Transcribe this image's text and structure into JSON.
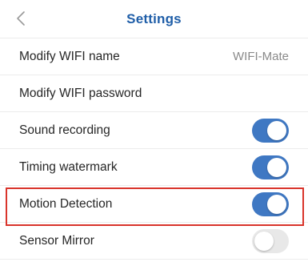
{
  "header": {
    "title": "Settings",
    "back_icon": "chevron-left-icon"
  },
  "settings": {
    "wifi_name": {
      "label": "Modify WIFI name",
      "value": "WIFI-Mate"
    },
    "wifi_password": {
      "label": "Modify WIFI password"
    },
    "sound_recording": {
      "label": "Sound recording",
      "enabled": true
    },
    "timing_watermark": {
      "label": "Timing watermark",
      "enabled": true
    },
    "motion_detection": {
      "label": "Motion Detection",
      "enabled": true,
      "highlighted": true
    },
    "sensor_mirror": {
      "label": "Sensor Mirror",
      "enabled": false
    }
  },
  "colors": {
    "accent": "#3f78c3",
    "title": "#1f5ea8",
    "toggle_off": "#e8e8e8",
    "highlight_border": "#d9342b",
    "separator": "#ececec"
  }
}
